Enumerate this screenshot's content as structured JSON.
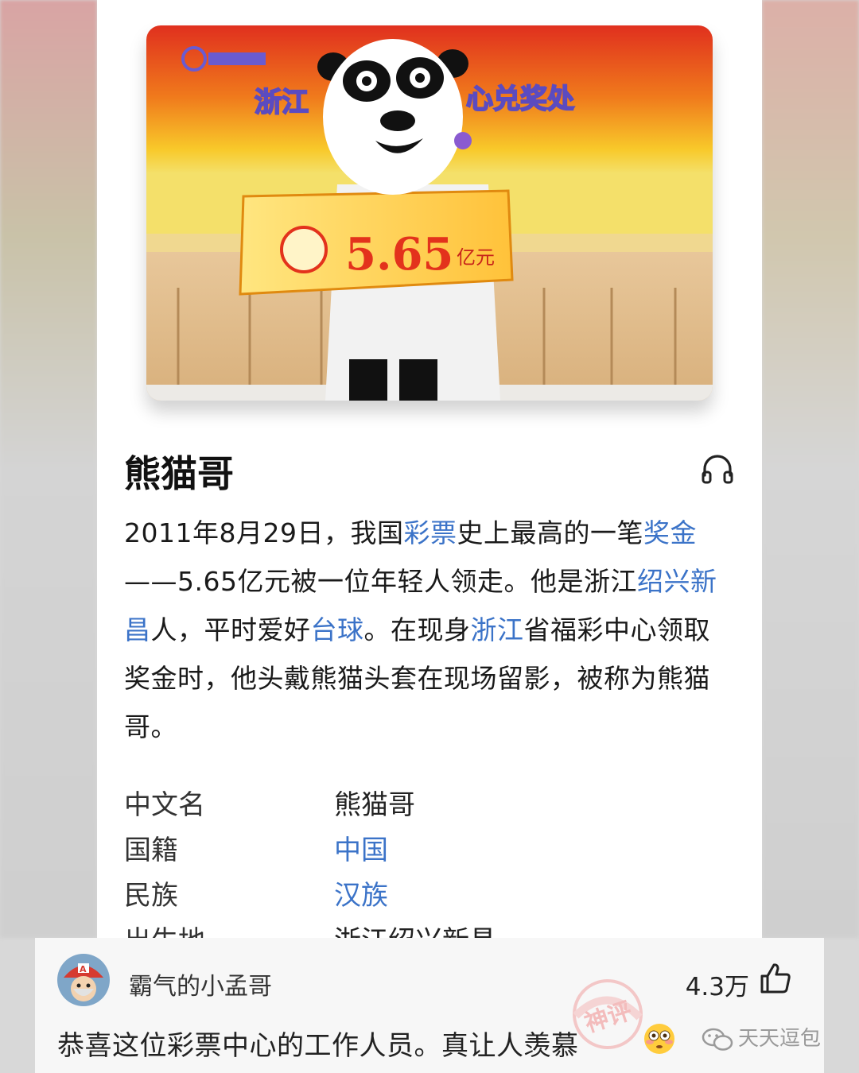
{
  "article": {
    "title": "熊猫哥",
    "description": [
      {
        "t": "2011年8月29日，我国",
        "link": false
      },
      {
        "t": "彩票",
        "link": true
      },
      {
        "t": "史上最高的一笔",
        "link": false
      },
      {
        "t": "奖金",
        "link": true
      },
      {
        "t": "——5.65亿元被一位年轻人领走。他是浙江",
        "link": false
      },
      {
        "t": "绍兴新昌",
        "link": true
      },
      {
        "t": "人，平时爱好",
        "link": false
      },
      {
        "t": "台球",
        "link": true
      },
      {
        "t": "。在现身",
        "link": false
      },
      {
        "t": "浙江",
        "link": true
      },
      {
        "t": "省福彩中心领取奖金时，他头戴熊猫头套在现场留影，被称为熊猫哥。",
        "link": false
      }
    ],
    "info": [
      {
        "label": "中文名",
        "value": "熊猫哥",
        "link": false
      },
      {
        "label": "国籍",
        "value": "中国",
        "link": true
      },
      {
        "label": "民族",
        "value": "汉族",
        "link": true
      },
      {
        "label": "出生地",
        "value": "浙江绍兴新昌",
        "link": false
      }
    ],
    "photo": {
      "banner_left": "浙江",
      "banner_right": "心兑奖处",
      "amount": "5.65",
      "amount_unit": "亿元"
    }
  },
  "comment": {
    "username": "霸气的小孟哥",
    "likes": "4.3万",
    "text": "恭喜这位彩票中心的工作人员。真让人羡慕",
    "stamp": "神评",
    "watermark": "天天逗包"
  },
  "colors": {
    "link": "#3b73c8",
    "text": "#1a1a1a"
  },
  "icons": [
    "headphone-icon",
    "thumbs-up-icon",
    "flushed-face-emoji",
    "wechat-icon"
  ]
}
